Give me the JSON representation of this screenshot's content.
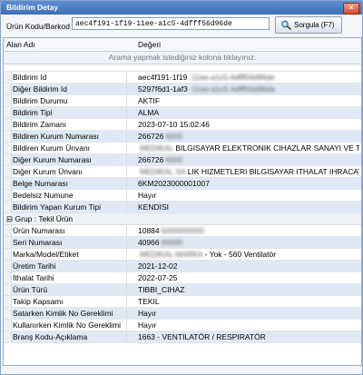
{
  "window": {
    "title": "Bildirim Detay",
    "close_label": "×"
  },
  "toolbar": {
    "barcode_label": "Ürün Kodu/Barkod",
    "barcode_value": "aec4f191-1f19-11ee-a1c5-4dfff56d96de",
    "search_label": "Sorgula (F7)",
    "search_icon": "magnifier-icon"
  },
  "grid": {
    "col_name": "Alan Adı",
    "col_value": "Değeri",
    "search_hint": "Arama yapmak istediğiniz kolona tıklayınız.",
    "group_label": "Grup : Tekil Ürün"
  },
  "rows": [
    {
      "name": "Bildirim Id",
      "v1": "aec4f191-1f19",
      "v2": "-11ee-a1c5-4dfff56d96de",
      "v3": ""
    },
    {
      "name": "Diğer Bildirim Id",
      "v1": "5297f6d1-1af3",
      "v2": "-11ee-a1c5-4dfff56d96de",
      "v3": ""
    },
    {
      "name": "Bildirim Durumu",
      "v1": "AKTIF",
      "v2": "",
      "v3": ""
    },
    {
      "name": "Bildirim Tipi",
      "v1": "ALMA",
      "v2": "",
      "v3": ""
    },
    {
      "name": "Bildirim Zamanı",
      "v1": "2023-07-10 15:02:46",
      "v2": "",
      "v3": ""
    },
    {
      "name": "Bildiren Kurum Numarası",
      "v1": "266726",
      "v2": "6000",
      "v3": ""
    },
    {
      "name": "Bildiren Kurum Ünvanı",
      "v1": "",
      "v2": "MEDIKAL",
      "v3": "BILGISAYAR ELEKTRONIK CIHAZLAR SANAYI VE TICARET"
    },
    {
      "name": "Diğer Kurum Numarası",
      "v1": "266726",
      "v2": "6000",
      "v3": ""
    },
    {
      "name": "Diğer Kurum Ünvanı",
      "v1": "",
      "v2": "MEDIKAL SA",
      "v3": "LIK HIZMETLERI BILGISAYAR ITHALAT IHRACAT SANAY"
    },
    {
      "name": "Belge Numarası",
      "v1": "6KM2023000001007",
      "v2": "",
      "v3": ""
    },
    {
      "name": "Bedelsiz Numune",
      "v1": "Hayır",
      "v2": "",
      "v3": ""
    },
    {
      "name": "Bildirim Yapan Kurum Tipi",
      "v1": "KENDISI",
      "v2": "",
      "v3": ""
    }
  ],
  "product_rows": [
    {
      "name": "Ürün Numarası",
      "v1": "10884",
      "v2": "5000000000",
      "v3": ""
    },
    {
      "name": "Seri Numarası",
      "v1": "40966",
      "v2": "00000",
      "v3": ""
    },
    {
      "name": "Marka/Model/Etiket",
      "v1": "",
      "v2": "MEDIKAL MARKA",
      "v3": "- Yok - 560 Ventilatör"
    },
    {
      "name": "Üretim Tarihi",
      "v1": "2021-12-02",
      "v2": "",
      "v3": ""
    },
    {
      "name": "İthalat Tarihi",
      "v1": "2022-07-25",
      "v2": "",
      "v3": ""
    },
    {
      "name": "Ürün Türü",
      "v1": "TIBBI_CIHAZ",
      "v2": "",
      "v3": ""
    },
    {
      "name": "Takip Kapsamı",
      "v1": "TEKIL",
      "v2": "",
      "v3": ""
    },
    {
      "name": "Satarken Kimlik No Gereklimi",
      "v1": "Hayır",
      "v2": "",
      "v3": ""
    },
    {
      "name": "Kullanırken Kimlik No Gereklimi",
      "v1": "Hayır",
      "v2": "",
      "v3": ""
    },
    {
      "name": "Branş Kodu-Açıklama",
      "v1": "1663 - VENTILATÖR / RESPIRATÖR",
      "v2": "",
      "v3": ""
    }
  ]
}
